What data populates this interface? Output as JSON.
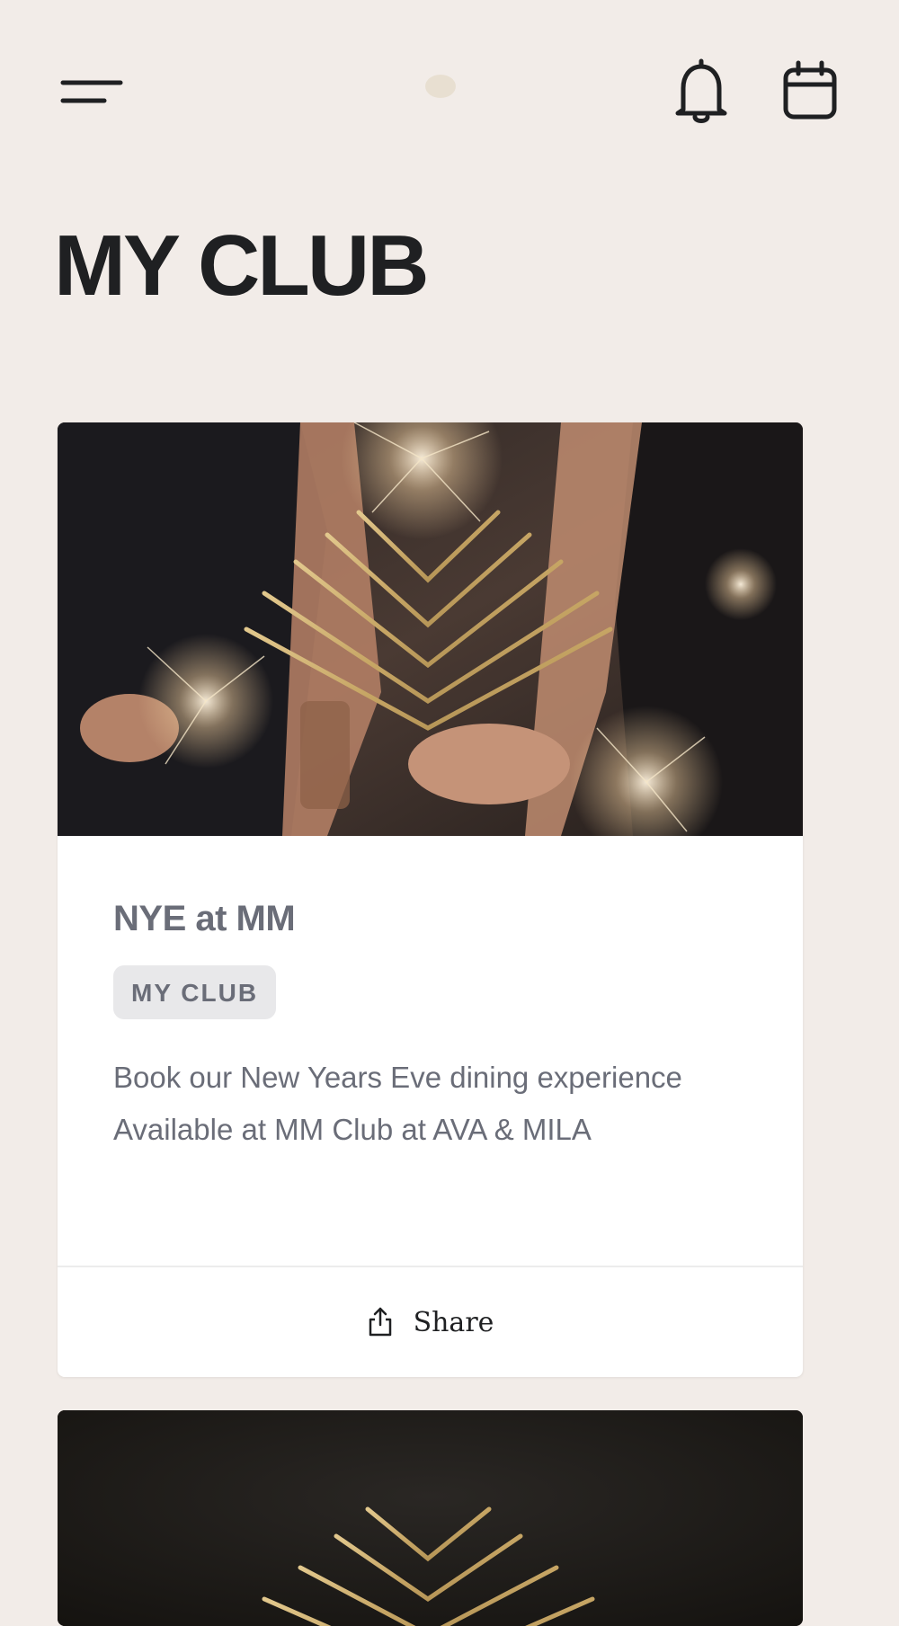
{
  "header": {
    "menu_icon": "menu-icon",
    "logo_icon": "palm-logo-icon",
    "notifications_icon": "bell-icon",
    "calendar_icon": "calendar-icon"
  },
  "page": {
    "title": "MY CLUB"
  },
  "cards": [
    {
      "title": "NYE at MM",
      "tag": "MY CLUB",
      "description_line1": "Book our New Years Eve dining experience",
      "description_line2": "Available at MM Club at AVA & MILA",
      "share_label": "Share",
      "share_icon": "share-icon",
      "image_logo_icon": "palm-logo-icon"
    },
    {
      "image_logo_icon": "palm-logo-icon"
    }
  ],
  "colors": {
    "background": "#f2ece8",
    "title_text": "#1f2022",
    "card_text": "#6a6d78",
    "tag_background": "#e8e8ea",
    "gold": "#c9ac6f"
  }
}
